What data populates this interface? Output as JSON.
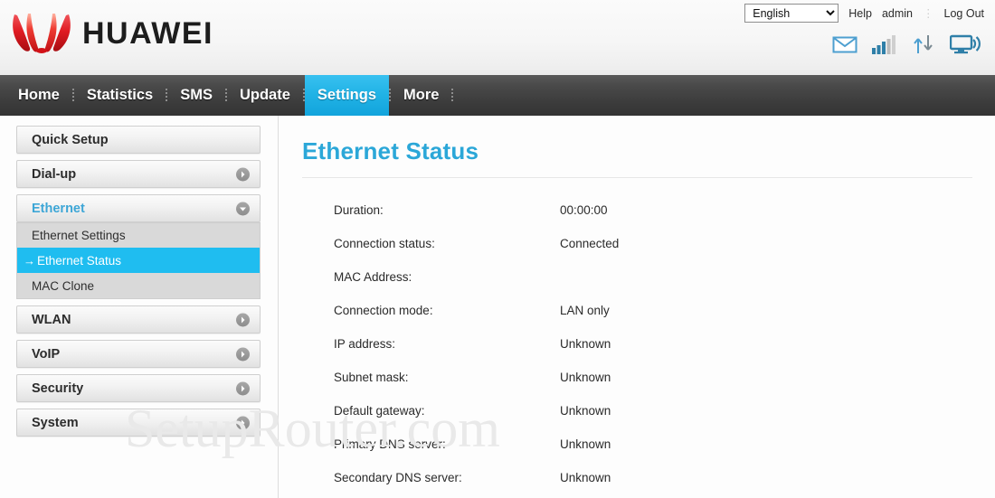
{
  "brand": {
    "name": "HUAWEI",
    "logo_icon": "huawei-flower-logo",
    "logo_color": "#d60f18"
  },
  "topbar": {
    "language_selected": "English",
    "language_options": [
      "English"
    ],
    "help_label": "Help",
    "user_label": "admin",
    "logout_label": "Log Out"
  },
  "status_icons": [
    {
      "name": "sms-envelope-icon",
      "label": "SMS"
    },
    {
      "name": "signal-bars-icon",
      "label": "Signal",
      "bars_filled": 3,
      "bars_total": 5
    },
    {
      "name": "data-transfer-icon",
      "label": "Data transfer"
    },
    {
      "name": "wifi-monitor-icon",
      "label": "WiFi"
    }
  ],
  "nav": {
    "active": "Settings",
    "items": [
      {
        "label": "Home"
      },
      {
        "label": "Statistics"
      },
      {
        "label": "SMS"
      },
      {
        "label": "Update"
      },
      {
        "label": "Settings"
      },
      {
        "label": "More"
      }
    ]
  },
  "sidebar": {
    "groups": [
      {
        "label": "Quick Setup",
        "state": "plain"
      },
      {
        "label": "Dial-up",
        "state": "collapsed"
      },
      {
        "label": "Ethernet",
        "state": "expanded",
        "items": [
          {
            "label": "Ethernet Settings",
            "active": false
          },
          {
            "label": "Ethernet Status",
            "active": true,
            "marker": "→"
          },
          {
            "label": "MAC Clone",
            "active": false
          }
        ]
      },
      {
        "label": "WLAN",
        "state": "collapsed"
      },
      {
        "label": "VoIP",
        "state": "collapsed"
      },
      {
        "label": "Security",
        "state": "collapsed"
      },
      {
        "label": "System",
        "state": "collapsed"
      }
    ]
  },
  "content": {
    "title": "Ethernet Status",
    "rows": [
      {
        "label": "Duration:",
        "value": "00:00:00"
      },
      {
        "label": "Connection status:",
        "value": "Connected"
      },
      {
        "label": "MAC Address:",
        "value": ""
      },
      {
        "label": "Connection mode:",
        "value": "LAN only"
      },
      {
        "label": "IP address:",
        "value": "Unknown"
      },
      {
        "label": "Subnet mask:",
        "value": "Unknown"
      },
      {
        "label": "Default gateway:",
        "value": "Unknown"
      },
      {
        "label": "Primary DNS server:",
        "value": "Unknown"
      },
      {
        "label": "Secondary DNS server:",
        "value": "Unknown"
      }
    ]
  },
  "watermark": {
    "text": "SetupRouter.com"
  },
  "colors": {
    "accent": "#2ba7d8",
    "active_tab": "#22b3e6",
    "active_item": "#1fbdf0",
    "nav_bg": "#3b3b3b"
  }
}
